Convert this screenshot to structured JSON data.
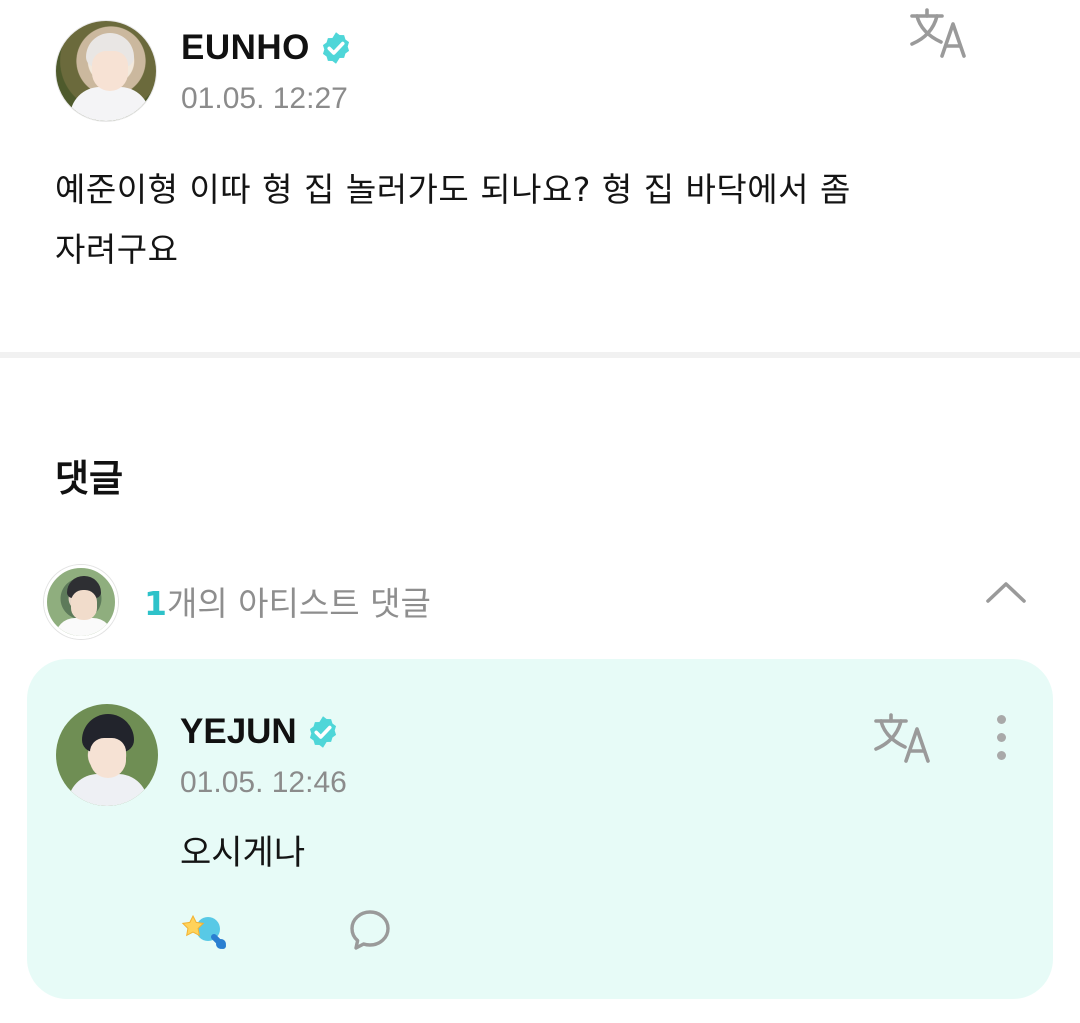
{
  "post": {
    "author": "EUNHO",
    "verified_icon": "verified-badge-icon",
    "timestamp": "01.05. 12:27",
    "body_line1": "예준이형 이따 형 집 놀러가도 되나요? 형 집 바닥에서 좀",
    "body_line2": "자려구요",
    "translate_icon": "translate-icon"
  },
  "comments": {
    "section_title": "댓글",
    "artist_comments": {
      "count": "1",
      "label": "개의 아티스트 댓글",
      "toggle_icon": "chevron-up-icon"
    },
    "reply": {
      "author": "YEJUN",
      "timestamp": "01.05. 12:46",
      "text": "오시게나",
      "actions": [
        "like-icon",
        "comment-bubble-icon",
        "more-vertical-icon"
      ]
    }
  },
  "colors": {
    "accent": "#2ec2c9",
    "verified": "#4fd6d8",
    "card_bg": "#e7fbf7",
    "muted_text": "#8b8b8b"
  }
}
